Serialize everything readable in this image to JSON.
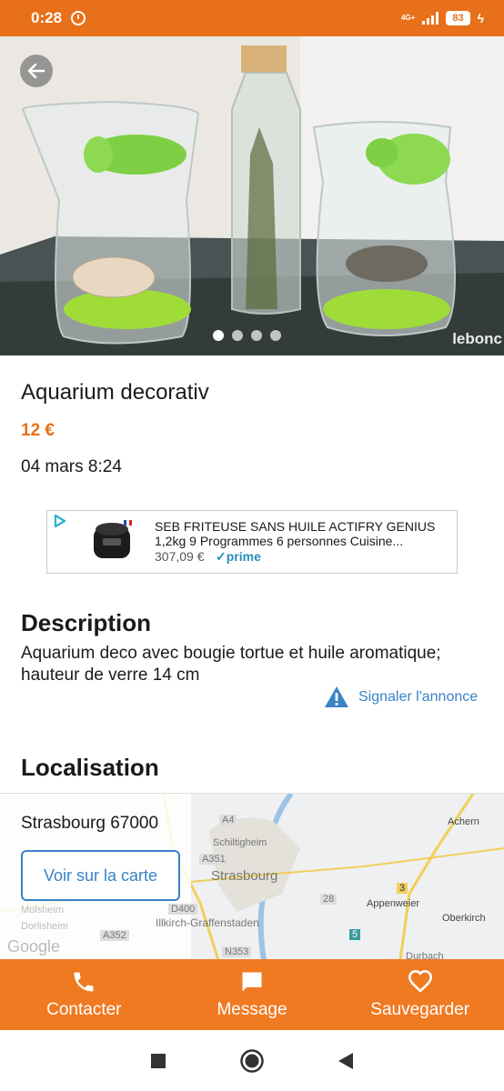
{
  "status_bar": {
    "time": "0:28",
    "network": "4G+",
    "battery": "83",
    "icons": [
      "alarm-icon",
      "signal-icon",
      "battery-icon",
      "charging-icon"
    ]
  },
  "gallery": {
    "watermark": "leboncoin",
    "image_count": 4,
    "active_index": 0
  },
  "listing": {
    "title": "Aquarium decorativ",
    "price": "12 €",
    "date": "04 mars 8:24"
  },
  "ad": {
    "title_line1": "SEB FRITEUSE SANS HUILE ACTIFRY GENIUS",
    "title_line2": "1,2kg 9 Programmes 6 personnes Cuisine...",
    "price": "307,09 €",
    "badge": "✓prime"
  },
  "description": {
    "heading": "Description",
    "text": "Aquarium deco avec bougie tortue et huile aromatique; hauteur de verre 14 cm",
    "report_label": "Signaler l'annonce"
  },
  "location": {
    "heading": "Localisation",
    "city": "Strasbourg 67000",
    "map_button": "Voir sur la carte",
    "map_labels": {
      "strasbourg": "Strasbourg",
      "illkirch": "Illkirch-Graffenstaden",
      "appenweier": "Appenweier",
      "oberkirch": "Oberkirch",
      "achern": "Achern",
      "schiltigheim": "Schiltigheim",
      "molsheim": "Molsheim",
      "dorlisheim": "Dorlisheim",
      "durbach": "Durbach",
      "road_a4": "A4",
      "road_a351": "A351",
      "road_a352": "A352",
      "road_d400": "D400",
      "road_n353": "N353",
      "road_28": "28",
      "road_3": "3",
      "road_5": "5",
      "google": "Google"
    }
  },
  "actions": {
    "contact": "Contacter",
    "message": "Message",
    "save": "Sauvegarder"
  },
  "colors": {
    "brand": "#e8701a",
    "link": "#3a82c4"
  }
}
